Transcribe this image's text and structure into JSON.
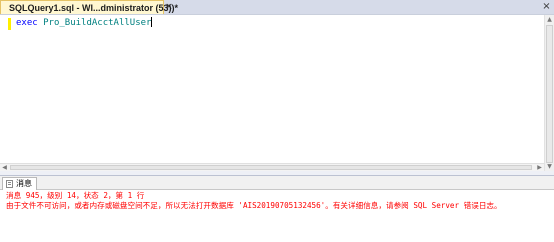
{
  "tabs": {
    "document_tab": "SQLQuery1.sql - WI...dministrator (53))*",
    "document_tab_close": "×",
    "window_close": "×"
  },
  "editor": {
    "keyword": "exec",
    "procedure": "Pro_BuildAcctAllUser"
  },
  "results": {
    "messages_tab_label": "消息",
    "message_line_1": "消息 945，级别 14，状态 2，第 1 行",
    "message_line_2": "由于文件不可访问，或者内存或磁盘空间不足，所以无法打开数据库 'AIS20190705132456'。有关详细信息，请参阅 SQL Server 错误日志。"
  },
  "icons": {
    "scroll_up": "▲",
    "scroll_down": "▼",
    "scroll_left": "◀",
    "scroll_right": "▶",
    "messages_icon": "document-lines-icon"
  },
  "colors": {
    "keyword": "#0000ff",
    "identifier": "#008080",
    "error_text": "#ff0000",
    "active_tab_bg": "#fff7d1",
    "line_marker": "#ffef00"
  }
}
